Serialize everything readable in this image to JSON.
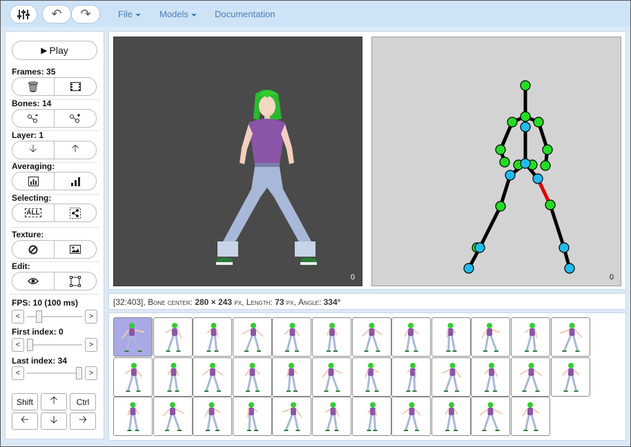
{
  "toolbar": {
    "tools_icon": "sliders-icon",
    "undo_icon": "undo-icon",
    "redo_icon": "redo-icon",
    "menus": [
      {
        "label": "File",
        "dropdown": true
      },
      {
        "label": "Models",
        "dropdown": true
      },
      {
        "label": "Documentation",
        "dropdown": false
      }
    ]
  },
  "sidebar": {
    "play_label": "Play",
    "frames_label": "Frames: 35",
    "bones_label": "Bones: 14",
    "layer_label": "Layer: 1",
    "averaging_label": "Averaging:",
    "selecting_label": "Selecting:",
    "select_all_label": "ALL",
    "texture_label": "Texture:",
    "edit_label": "Edit:",
    "fps_label": "FPS: 10 (100 ms)",
    "first_index_label": "First index: 0",
    "last_index_label": "Last index: 34",
    "slider_left": "<",
    "slider_right": ">",
    "shift_label": "Shift",
    "ctrl_label": "Ctrl",
    "fps_slider": 0.18,
    "first_index_slider": 0.0,
    "last_index_slider": 1.0
  },
  "viewport": {
    "model_frame_number": "0",
    "skeleton_frame_number": "0"
  },
  "status": {
    "coords": "[32:403],",
    "bone_center_label": "Bone center:",
    "bone_center_value": "280 × 243",
    "px1": "px",
    "sep1": ",",
    "length_label": "Length:",
    "length_value": "73",
    "px2": "px",
    "sep2": ",",
    "angle_label": "Angle:",
    "angle_value": "334°"
  },
  "frames": {
    "count": 35,
    "selected_index": 0
  },
  "colors": {
    "joint_green": "#22dd22",
    "joint_blue": "#22bbee",
    "bone_black": "#000000",
    "bone_selected": "#ee0000",
    "selected_tile": "#a9a9e6"
  }
}
